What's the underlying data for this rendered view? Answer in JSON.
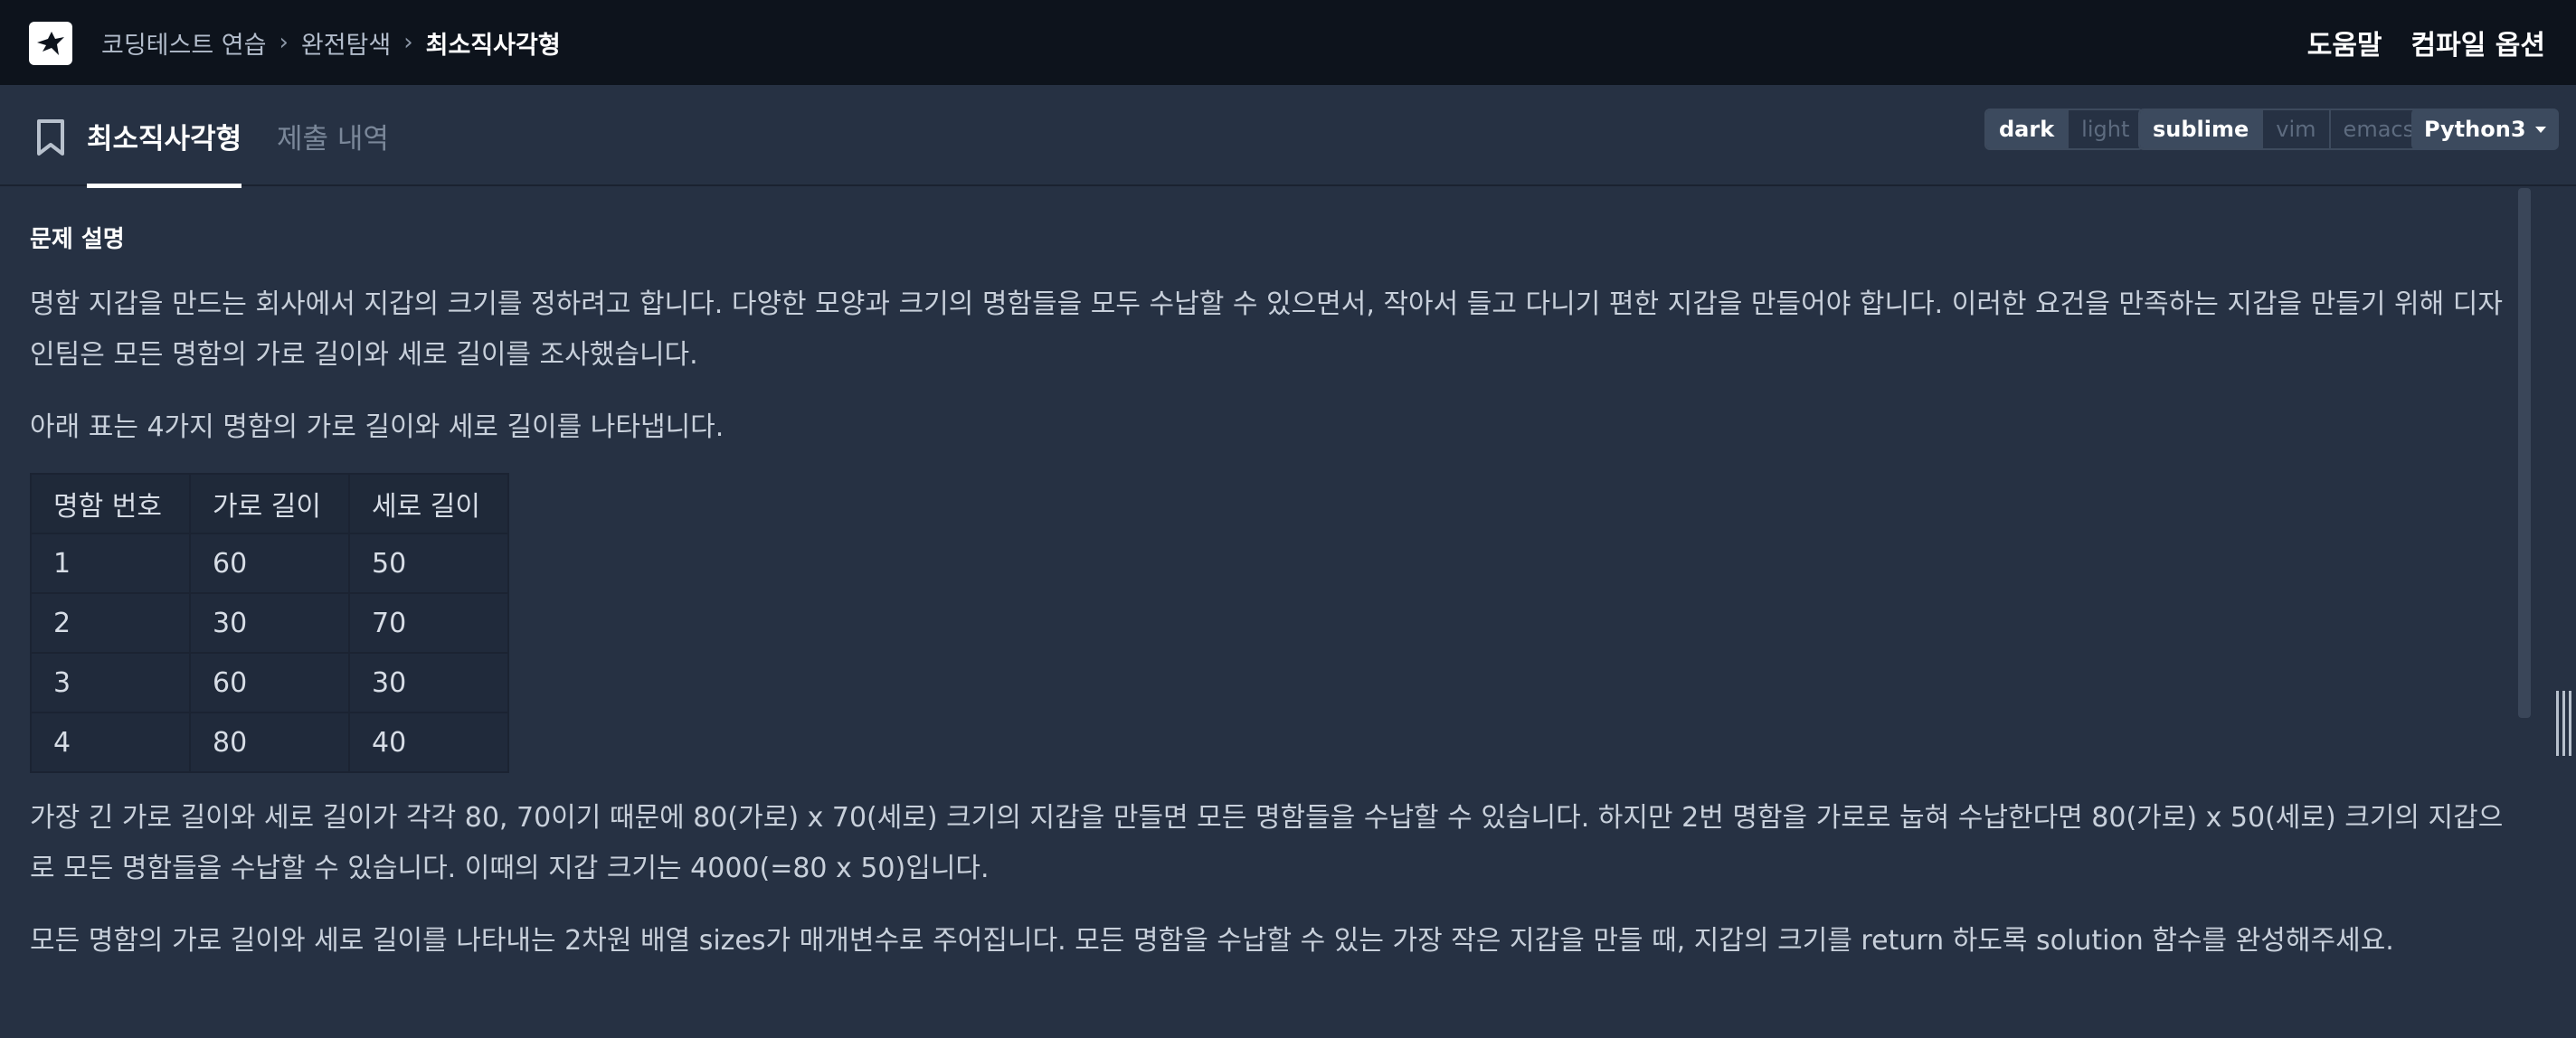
{
  "breadcrumb": {
    "items": [
      "코딩테스트 연습",
      "완전탐색",
      "최소직사각형"
    ]
  },
  "header": {
    "help": "도움말",
    "compile_options": "컴파일 옵션"
  },
  "tabs": {
    "problem": "최소직사각형",
    "submissions": "제출 내역"
  },
  "editor_settings": {
    "theme": {
      "options": [
        "dark",
        "light"
      ],
      "selected": "dark"
    },
    "keymap": {
      "options": [
        "sublime",
        "vim",
        "emacs"
      ],
      "selected": "sublime"
    },
    "language": "Python3"
  },
  "problem": {
    "section_title": "문제 설명",
    "p1": "명함 지갑을 만드는 회사에서 지갑의 크기를 정하려고 합니다. 다양한 모양과 크기의 명함들을 모두 수납할 수 있으면서, 작아서 들고 다니기 편한 지갑을 만들어야 합니다. 이러한 요건을 만족하는 지갑을 만들기 위해 디자인팀은 모든 명함의 가로 길이와 세로 길이를 조사했습니다.",
    "p2": "아래 표는 4가지 명함의 가로 길이와 세로 길이를 나타냅니다.",
    "table": {
      "headers": [
        "명함 번호",
        "가로 길이",
        "세로 길이"
      ],
      "rows": [
        [
          "1",
          "60",
          "50"
        ],
        [
          "2",
          "30",
          "70"
        ],
        [
          "3",
          "60",
          "30"
        ],
        [
          "4",
          "80",
          "40"
        ]
      ]
    },
    "p3": "가장 긴 가로 길이와 세로 길이가 각각 80, 70이기 때문에 80(가로) x 70(세로) 크기의 지갑을 만들면 모든 명함들을 수납할 수 있습니다. 하지만 2번 명함을 가로로 눕혀 수납한다면 80(가로) x 50(세로) 크기의 지갑으로 모든 명함들을 수납할 수 있습니다. 이때의 지갑 크기는 4000(=80 x 50)입니다.",
    "p4": "모든 명함의 가로 길이와 세로 길이를 나타내는 2차원 배열 sizes가 매개변수로 주어집니다. 모든 명함을 수납할 수 있는 가장 작은 지갑을 만들 때, 지갑의 크기를 return 하도록 solution 함수를 완성해주세요."
  },
  "colors": {
    "topbar_bg": "#0d131c",
    "page_bg": "#263143",
    "accent_text": "#ffffff"
  }
}
